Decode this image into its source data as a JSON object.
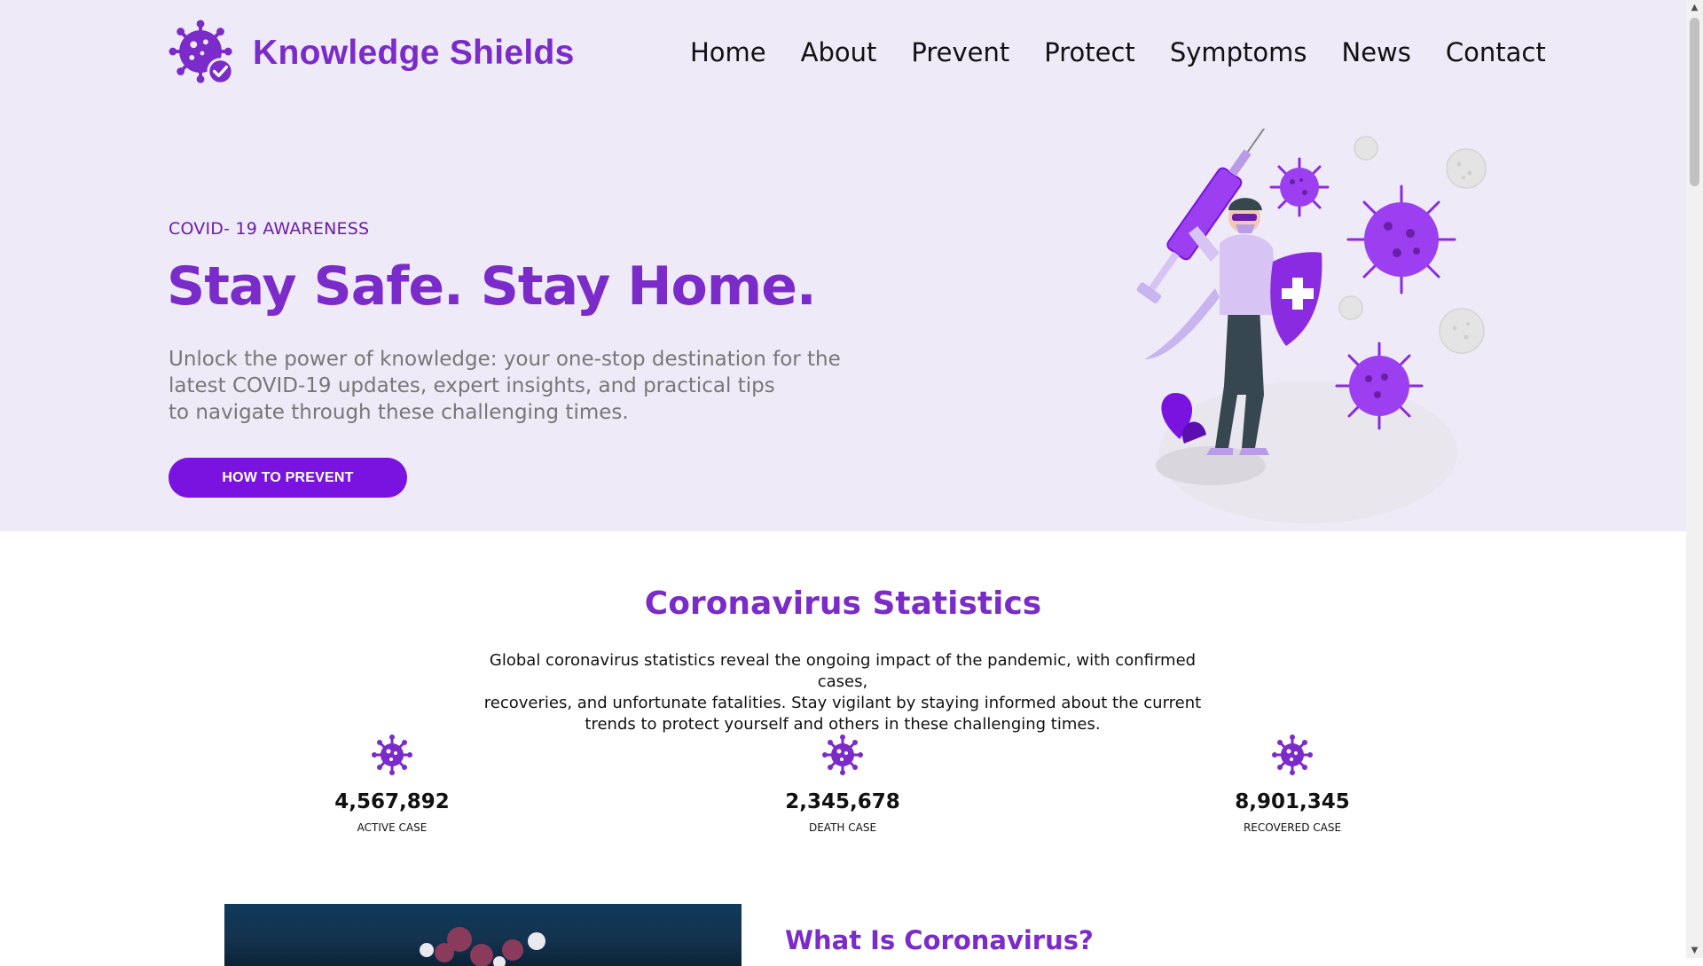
{
  "header": {
    "brand": "Knowledge Shields",
    "nav": [
      "Home",
      "About",
      "Prevent",
      "Protect",
      "Symptoms",
      "News",
      "Contact"
    ]
  },
  "hero": {
    "eyebrow": "COVID- 19 AWARENESS",
    "title": "Stay Safe. Stay Home.",
    "description": [
      "Unlock the power of knowledge: your one-stop destination for the",
      "latest COVID-19 updates, expert insights, and practical tips",
      "to navigate through these challenging times."
    ],
    "cta": "HOW TO PREVENT"
  },
  "stats": {
    "title": "Coronavirus Statistics",
    "description": [
      "Global coronavirus statistics reveal the ongoing impact of the pandemic, with confirmed cases,",
      "recoveries, and unfortunate fatalities. Stay vigilant by staying informed about the current",
      "trends to protect yourself and others in these challenging times."
    ],
    "items": [
      {
        "value": "4,567,892",
        "label": "ACTIVE CASE",
        "icon": "virus-icon"
      },
      {
        "value": "2,345,678",
        "label": "DEATH CASE",
        "icon": "virus-icon"
      },
      {
        "value": "8,901,345",
        "label": "RECOVERED CASE",
        "icon": "virus-icon"
      }
    ]
  },
  "about": {
    "title": "What Is Coronavirus?"
  },
  "colors": {
    "accent": "#7b2bc9",
    "button": "#7a13e0",
    "hero_bg": "#efeaf7"
  }
}
